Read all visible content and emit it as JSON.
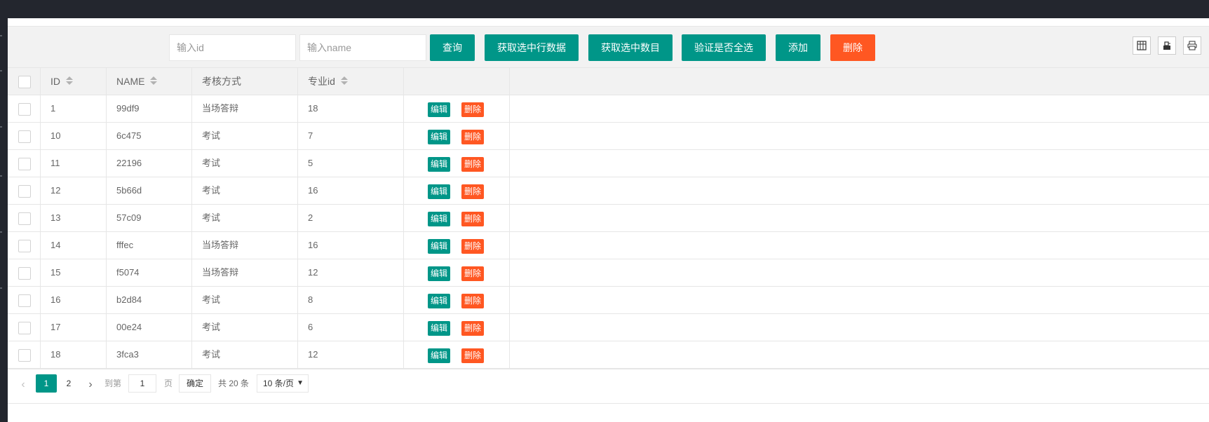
{
  "toolbar": {
    "id_placeholder": "输入id",
    "name_placeholder": "输入name",
    "query_label": "查询",
    "get_selected_rows_label": "获取选中行数据",
    "get_selected_count_label": "获取选中数目",
    "verify_all_selected_label": "验证是否全选",
    "add_label": "添加",
    "delete_label": "删除",
    "colors": {
      "primary": "#009688",
      "danger": "#ff5722"
    },
    "right_tools": [
      "columns-filter-icon",
      "export-icon",
      "print-icon"
    ]
  },
  "table": {
    "columns": [
      "ID",
      "NAME",
      "考核方式",
      "专业id",
      ""
    ],
    "rows": [
      {
        "id": "1",
        "name": "99df9",
        "method": "当场答辩",
        "major_id": "18"
      },
      {
        "id": "10",
        "name": "6c475",
        "method": "考试",
        "major_id": "7"
      },
      {
        "id": "11",
        "name": "22196",
        "method": "考试",
        "major_id": "5"
      },
      {
        "id": "12",
        "name": "5b66d",
        "method": "考试",
        "major_id": "16"
      },
      {
        "id": "13",
        "name": "57c09",
        "method": "考试",
        "major_id": "2"
      },
      {
        "id": "14",
        "name": "fffec",
        "method": "当场答辩",
        "major_id": "16"
      },
      {
        "id": "15",
        "name": "f5074",
        "method": "当场答辩",
        "major_id": "12"
      },
      {
        "id": "16",
        "name": "b2d84",
        "method": "考试",
        "major_id": "8"
      },
      {
        "id": "17",
        "name": "00e24",
        "method": "考试",
        "major_id": "6"
      },
      {
        "id": "18",
        "name": "3fca3",
        "method": "考试",
        "major_id": "12"
      }
    ],
    "row_actions": {
      "edit": "编辑",
      "delete": "删除"
    }
  },
  "pager": {
    "pages": [
      "1",
      "2"
    ],
    "current": "1",
    "goto_prefix": "到第",
    "goto_value": "1",
    "goto_suffix": "页",
    "confirm": "确定",
    "total_text": "共 20 条",
    "page_size": "10 条/页"
  }
}
